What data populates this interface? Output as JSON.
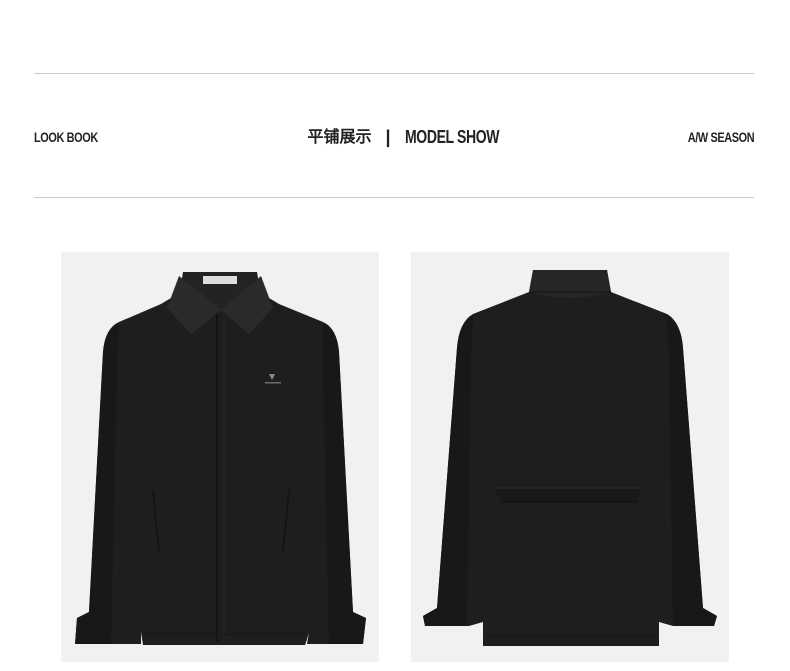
{
  "header": {
    "left_label": "LOOK BOOK",
    "center_cn": "平铺展示",
    "divider": "|",
    "center_en": "MODEL SHOW",
    "right_label": "A/W SEASON"
  },
  "images": {
    "front": {
      "icon": "jacket-front-image"
    },
    "back": {
      "icon": "jacket-back-image"
    }
  },
  "colors": {
    "background": "#ffffff",
    "rule": "#c9c9c9",
    "photo_bg": "#f0f1f3",
    "garment": "#1e1e1e"
  }
}
